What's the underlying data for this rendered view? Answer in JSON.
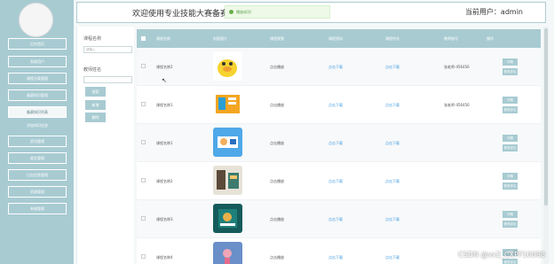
{
  "header": {
    "title": "欢迎使用专业技能大赛备赛平台",
    "user_label": "当前用户：admin"
  },
  "toast": {
    "text": "播放成功!"
  },
  "sidebar": {
    "items": [
      {
        "label": "后台首页"
      },
      {
        "label": "系统用户"
      },
      {
        "label": "课程分类管理"
      },
      {
        "label": "备赛知识管理"
      },
      {
        "label": "备赛知识列表"
      },
      {
        "label": "添加知识信息"
      },
      {
        "label": "资讯管理"
      },
      {
        "label": "留言管理"
      },
      {
        "label": "日志信息管理"
      },
      {
        "label": "资源管理"
      },
      {
        "label": "系统管理"
      }
    ]
  },
  "filter": {
    "name_label": "课程名称",
    "name_placeholder": "请输入",
    "teacher_label": "教师姓名",
    "teacher_placeholder": "",
    "search_label": "搜索",
    "add_label": "新增",
    "delete_label": "删除"
  },
  "table": {
    "columns": [
      "课程名称",
      "封面图片",
      "课程视频",
      "课程资料",
      "课程作业",
      "教师账号",
      "操作"
    ],
    "rows": [
      {
        "name": "课程名称2",
        "video": "点击播放",
        "material": "点击下载",
        "homework": "点击下载",
        "teacher": "张老师-456456",
        "actions": [
          "详情",
          "修改评论"
        ],
        "thumb": "duck"
      },
      {
        "name": "课程名称1",
        "video": "点击播放",
        "material": "点击下载",
        "homework": "点击下载",
        "teacher": "张老师-456456",
        "actions": [
          "详情",
          "修改评论"
        ],
        "thumb": "orange"
      },
      {
        "name": "课程名称1",
        "video": "点击播放",
        "material": "点击下载",
        "homework": "点击下载",
        "teacher": "",
        "actions": [
          "详情",
          "修改评论"
        ],
        "thumb": "blue"
      },
      {
        "name": "课程名称2",
        "video": "点击播放",
        "material": "点击下载",
        "homework": "点击下载",
        "teacher": "",
        "actions": [
          "详情",
          "修改评论"
        ],
        "thumb": "room"
      },
      {
        "name": "课程名称3",
        "video": "点击播放",
        "material": "点击下载",
        "homework": "点击下载",
        "teacher": "",
        "actions": [
          "详情",
          "修改评论"
        ],
        "thumb": "teal"
      },
      {
        "name": "课程名称4",
        "video": "点击播放",
        "material": "点击下载",
        "homework": "点击下载",
        "teacher": "",
        "actions": [
          "详情",
          "修改评论"
        ],
        "thumb": "pink"
      }
    ]
  },
  "watermark": "CSDN @vx2_CXPF10088",
  "colors": {
    "accent": "#a8cbd2",
    "link": "#3f9ae0",
    "toast_green": "#6ab04c"
  }
}
